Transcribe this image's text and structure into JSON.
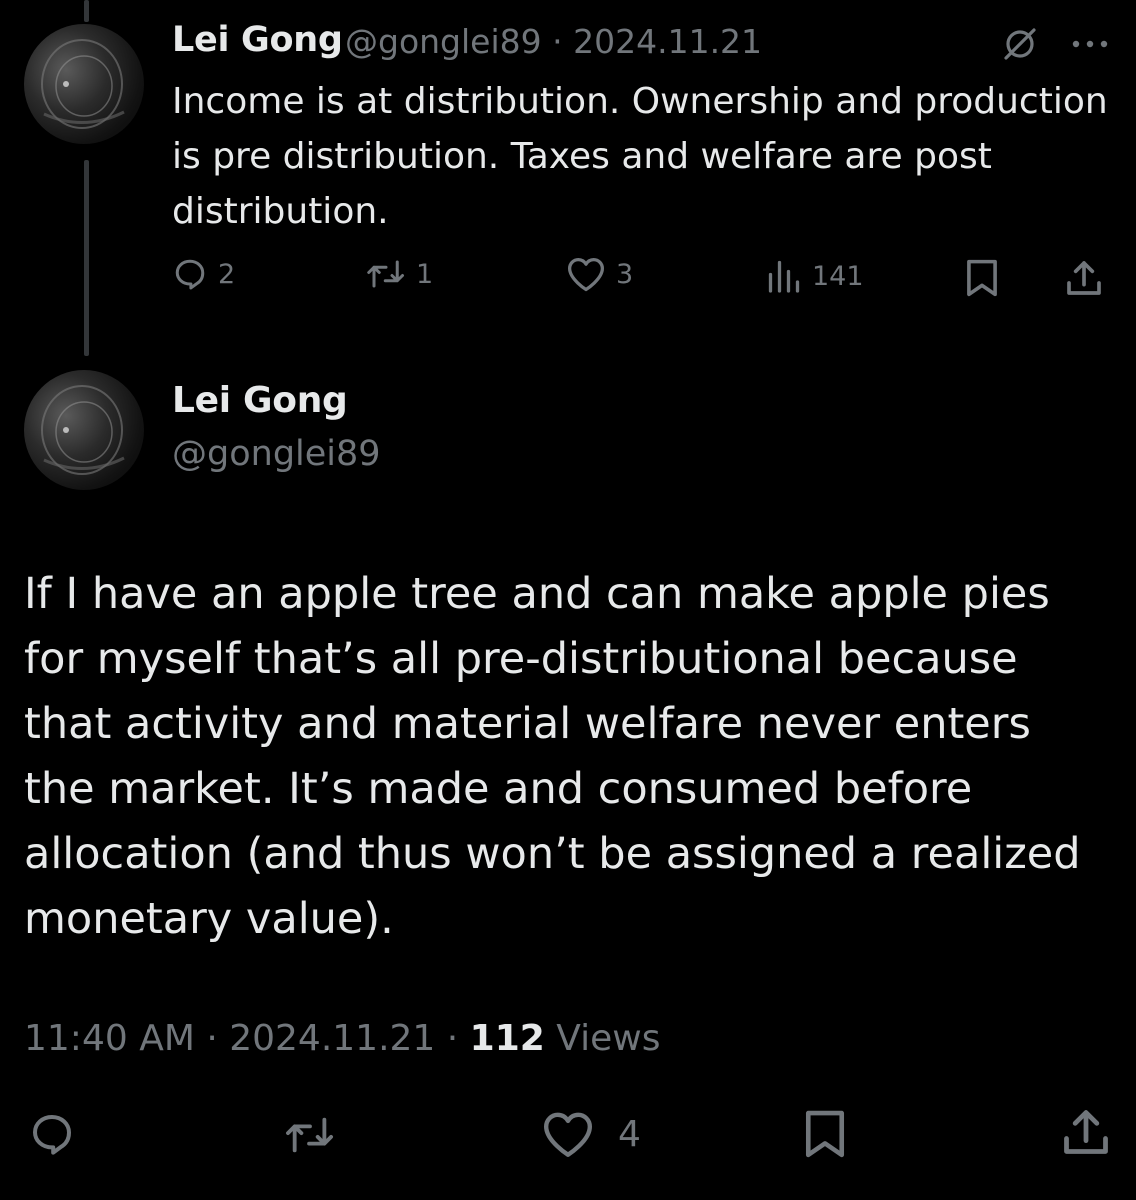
{
  "parent_tweet": {
    "author_name": "Lei Gong",
    "meta_line": "@gonglei89 · 2024.11.21",
    "text": "Income is at distribution. Ownership and production is pre distribution. Taxes and welfare are post distribution.",
    "reply_count": "2",
    "retweet_count": "1",
    "like_count": "3",
    "views_count": "141"
  },
  "main_tweet": {
    "author_name": "Lei Gong",
    "handle": "@gonglei89",
    "text": "If I have an apple tree and can make apple pies for myself that’s all pre-distributional because that activity and material welfare never enters the market. It’s made and consumed before allocation (and thus won’t be assigned a realized monetary value).",
    "meta_prefix": "11:40 AM · 2024.11.21 · ",
    "views_count": "112",
    "views_label": " Views",
    "like_count": "4"
  },
  "icons": {
    "reply": "reply-icon",
    "retweet": "retweet-icon",
    "like": "heart-icon",
    "views": "views-icon",
    "bookmark": "bookmark-icon",
    "share": "share-icon",
    "grok": "grok-icon",
    "more": "more-icon"
  },
  "colors": {
    "background": "#000000",
    "primary_text": "#e7e9ea",
    "secondary_text": "#71767b",
    "thread_line": "#333639"
  }
}
